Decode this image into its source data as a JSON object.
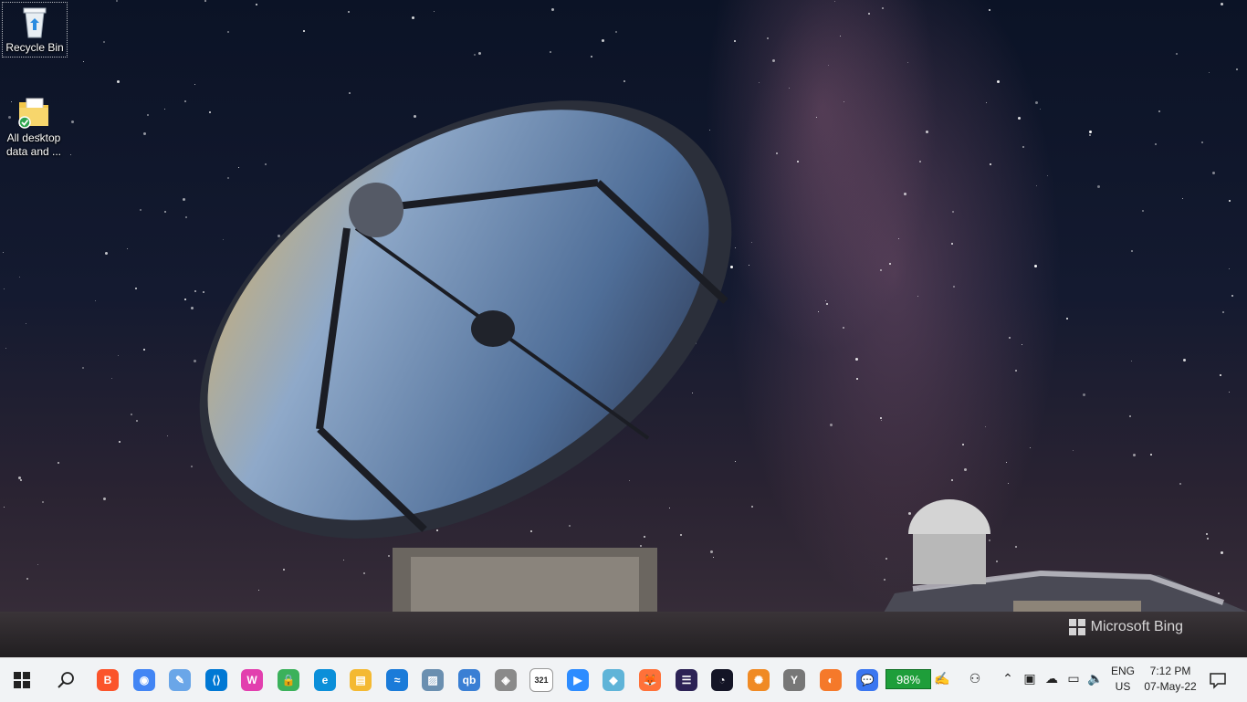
{
  "desktop": {
    "icons": [
      {
        "label": "Recycle Bin",
        "icon": "recycle-bin-icon"
      },
      {
        "label": "All desktop data and ...",
        "icon": "folder-icon"
      }
    ],
    "watermark": "Microsoft Bing"
  },
  "taskbar": {
    "start_icon": "windows-start-icon",
    "search_icon": "search-icon",
    "apps": [
      {
        "name": "brave",
        "icon": "brave-icon",
        "color": "#fb542b",
        "glyph": "B"
      },
      {
        "name": "chrome",
        "icon": "chrome-icon",
        "color": "#4285f4",
        "glyph": "◉"
      },
      {
        "name": "paint",
        "icon": "paint-icon",
        "color": "#6aa6e8",
        "glyph": "✎"
      },
      {
        "name": "vscode",
        "icon": "vscode-icon",
        "color": "#0078d4",
        "glyph": "⟨⟩"
      },
      {
        "name": "app-w",
        "icon": "w-app-icon",
        "color": "#e23fae",
        "glyph": "W"
      },
      {
        "name": "vpn",
        "icon": "lock-vpn-icon",
        "color": "#3bb15b",
        "glyph": "🔒"
      },
      {
        "name": "edge",
        "icon": "edge-icon",
        "color": "#0b8fd9",
        "glyph": "e"
      },
      {
        "name": "file-explorer",
        "icon": "folder-icon",
        "color": "#f4b932",
        "glyph": "▤"
      },
      {
        "name": "app-sync",
        "icon": "sync-icon",
        "color": "#1a7bd9",
        "glyph": "≈"
      },
      {
        "name": "photos",
        "icon": "photos-icon",
        "color": "#6a8fb0",
        "glyph": "▨"
      },
      {
        "name": "qbittorrent",
        "icon": "qbittorrent-icon",
        "color": "#3a7fd4",
        "glyph": "qb"
      },
      {
        "name": "shield-app",
        "icon": "shield-icon",
        "color": "#8a8a8a",
        "glyph": "◈"
      },
      {
        "name": "calendar",
        "icon": "calendar-icon",
        "color": "#ffffff",
        "glyph": "321"
      },
      {
        "name": "zoom",
        "icon": "zoom-icon",
        "color": "#2d8cff",
        "glyph": "▶"
      },
      {
        "name": "app-cube",
        "icon": "cube-icon",
        "color": "#5fb4d8",
        "glyph": "◆"
      },
      {
        "name": "firefox",
        "icon": "firefox-icon",
        "color": "#ff7139",
        "glyph": "🦊"
      },
      {
        "name": "eclipse",
        "icon": "eclipse-icon",
        "color": "#2c2255",
        "glyph": "☰"
      },
      {
        "name": "speedtest",
        "icon": "speedometer-icon",
        "color": "#141526",
        "glyph": "◔"
      },
      {
        "name": "app-swirl",
        "icon": "swirl-icon",
        "color": "#f08a24",
        "glyph": "✺"
      },
      {
        "name": "app-clock",
        "icon": "clock-badge-icon",
        "color": "#777777",
        "glyph": "Y"
      },
      {
        "name": "blender",
        "icon": "blender-icon",
        "color": "#f5792a",
        "glyph": "◐"
      },
      {
        "name": "signal",
        "icon": "signal-icon",
        "color": "#3a76f0",
        "glyph": "💬"
      }
    ],
    "battery": "98%",
    "tray_icons": [
      "pen-icon",
      "people-icon",
      "chevron-up-icon",
      "webcam-icon",
      "cloud-icon",
      "battery-icon",
      "volume-icon"
    ],
    "language": {
      "line1": "ENG",
      "line2": "US"
    },
    "clock": {
      "time": "7:12 PM",
      "date": "07-May-22"
    },
    "notification_icon": "notification-icon"
  }
}
